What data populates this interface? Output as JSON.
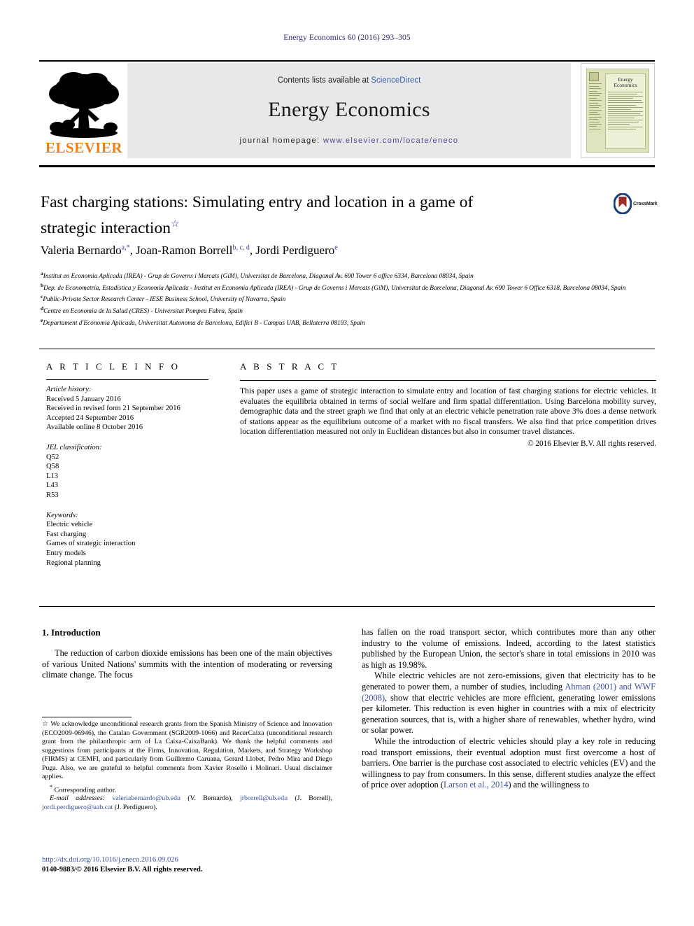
{
  "running_head": "Energy Economics 60 (2016) 293–305",
  "masthead": {
    "contents_prefix": "Contents lists available at ",
    "sciencedirect": "ScienceDirect",
    "journal_title": "Energy Economics",
    "homepage_label": "journal homepage:",
    "homepage_url": "www.elsevier.com/locate/eneco",
    "publisher_logo_word": "ELSEVIER",
    "cover_title": "Energy Economics"
  },
  "article": {
    "title": "Fast charging stations: Simulating entry and location in a game of strategic interaction",
    "title_footnote_marker": "☆",
    "authors_html": "Valeria Bernardo<sup>a,</sup><sup>*</sup>, Joan-Ramon Borrell<sup>b, c, d</sup>, Jordi Perdiguero<sup>e</sup>",
    "affiliations": [
      "Institut en Economia Aplicada (IREA) - Grup de Governs i Mercats (GiM), Universitat de Barcelona, Diagonal Av. 690 Tower 6 office 6334, Barcelona 08034, Spain",
      "Dep. de Econometría, Estadística y Economía Aplicada - Institut en Economia Aplicada (IREA) - Grup de Governs i Mercats (GiM), Universitat de Barcelona, Diagonal Av. 690 Tower 6 Office 6318, Barcelona 08034, Spain",
      "Public-Private Sector Research Center - IESE Business School, University of Navarra, Spain",
      "Centre en Economia de la Salud (CRES) - Universitat Pompeu Fabra, Spain",
      "Departament d'Economia Aplicada, Universitat Autonoma de Barcelona, Edifici B - Campus UAB, Bellaterra 08193, Spain"
    ],
    "affiliation_markers": [
      "a",
      "b",
      "c",
      "d",
      "e"
    ]
  },
  "crossmark": {
    "label": "CrossMark"
  },
  "article_info": {
    "heading": "A R T I C L E   I N F O",
    "history_label": "Article history:",
    "history": [
      "Received 5 January 2016",
      "Received in revised form 21 September 2016",
      "Accepted 24 September 2016",
      "Available online 8 October 2016"
    ],
    "jel_label": "JEL classification:",
    "jel_codes": [
      "Q52",
      "Q58",
      "L13",
      "L43",
      "R53"
    ],
    "keywords_label": "Keywords:",
    "keywords": [
      "Electric vehicle",
      "Fast charging",
      "Games of strategic interaction",
      "Entry models",
      "Regional planning"
    ]
  },
  "abstract": {
    "heading": "A B S T R A C T",
    "text": "This paper uses a game of strategic interaction to simulate entry and location of fast charging stations for electric vehicles. It evaluates the equilibria obtained in terms of social welfare and firm spatial differentiation. Using Barcelona mobility survey, demographic data and the street graph we find that only at an electric vehicle penetration rate above 3% does a dense network of stations appear as the equilibrium outcome of a market with no fiscal transfers. We also find that price competition drives location differentiation measured not only in Euclidean distances but also in consumer travel distances.",
    "copyright": "© 2016 Elsevier B.V. All rights reserved."
  },
  "body": {
    "section_number_title": "1. Introduction",
    "left_paragraph_1": "The reduction of carbon dioxide emissions has been one of the main objectives of various United Nations' summits with the intention of moderating or reversing climate change. The focus",
    "right_paragraph_1": "has fallen on the road transport sector, which contributes more than any other industry to the volume of emissions. Indeed, according to the latest statistics published by the European Union, the sector's share in total emissions in 2010 was as high as 19.98%.",
    "right_paragraph_2_a": "While electric vehicles are not zero-emissions, given that electricity has to be generated to power them, a number of studies, including ",
    "right_paragraph_2_cite": "Ahman (2001) and WWF (2008)",
    "right_paragraph_2_b": ", show that electric vehicles are more efficient, generating lower emissions per kilometer. This reduction is even higher in countries with a mix of electricity generation sources, that is, with a higher share of renewables, whether hydro, wind or solar power.",
    "right_paragraph_3_a": "While the introduction of electric vehicles should play a key role in reducing road transport emissions, their eventual adoption must first overcome a host of barriers. One barrier is the purchase cost associated to electric vehicles (EV) and the willingness to pay from consumers. In this sense, different studies analyze the effect of price over adoption (",
    "right_paragraph_3_cite": "Larson et al., 2014",
    "right_paragraph_3_b": ") and the willingness to"
  },
  "footnote": {
    "marker": "☆",
    "acknowledgement": "We acknowledge unconditional research grants from the Spanish Ministry of Science and Innovation (ECO2009-06946), the Catalan Government (SGR2009-1066) and RecerCaixa (unconditional research grant from the philanthropic arm of La Caixa-CaixaBank). We thank the helpful comments and suggestions from participants at the Firms, Innovation, Regulation, Markets, and Strategy Workshop (FIRMS) at CEMFI, and particularly from Guillermo Caruana, Gerard Llobet, Pedro Mira and Diego Puga. Also, we are grateful to helpful comments from Xavier Roselló i Molinari. Usual disclaimer applies.",
    "corresponding_marker": "*",
    "corresponding_author": "Corresponding author.",
    "email_label": "E-mail addresses:",
    "emails": [
      {
        "address": "valeriabernardo@ub.edu",
        "owner": "(V. Bernardo)"
      },
      {
        "address": "jrborrell@ub.edu",
        "owner": "(J. Borrell)"
      },
      {
        "address": "jordi.perdiguero@uab.cat",
        "owner": "(J. Perdiguero)"
      }
    ]
  },
  "bottom": {
    "doi": "http://dx.doi.org/10.1016/j.eneco.2016.09.026",
    "issn_copyright": "0140-9883/© 2016 Elsevier B.V. All rights reserved."
  },
  "colors": {
    "running_head": "#2e2e6b",
    "link": "#3b5ea8",
    "cite": "#3b4f9e",
    "elsevier_orange": "#ef7f1a",
    "banner_bg": "#e8e8e8"
  }
}
